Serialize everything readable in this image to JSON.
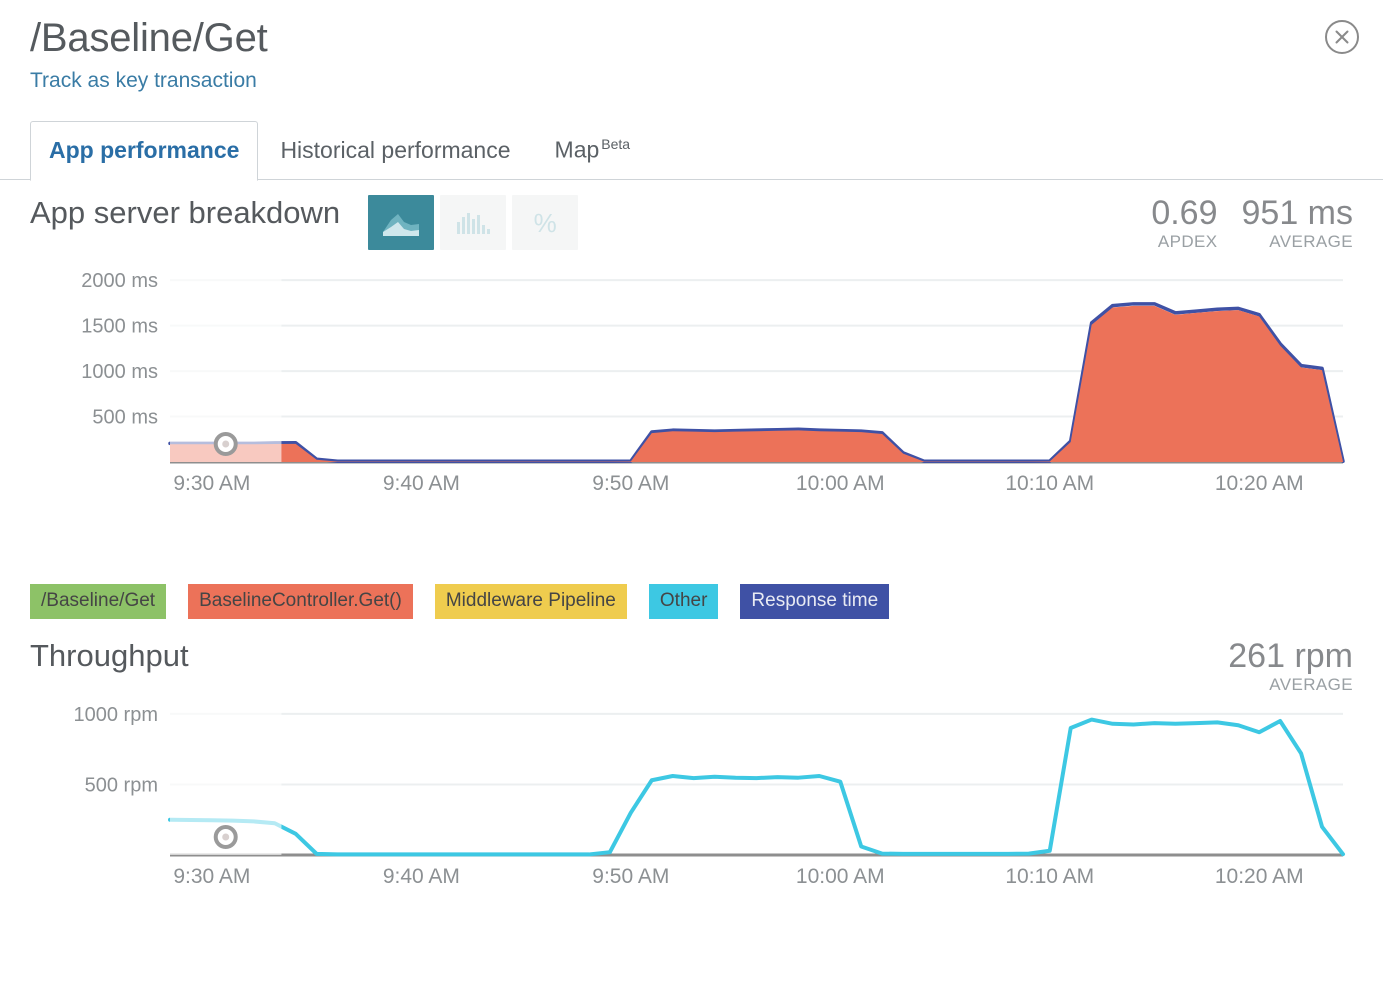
{
  "header": {
    "title": "/Baseline/Get",
    "track_link": "Track as key transaction",
    "close_icon": "close-circle-icon"
  },
  "tabs": [
    {
      "label": "App performance",
      "active": true
    },
    {
      "label": "Historical performance",
      "active": false
    },
    {
      "label": "Map",
      "badge": "Beta",
      "active": false
    }
  ],
  "app_breakdown": {
    "title": "App server breakdown",
    "chart_types": [
      {
        "icon": "area-chart-icon",
        "active": true
      },
      {
        "icon": "bar-chart-icon",
        "active": false
      },
      {
        "icon": "percent-icon",
        "active": false
      }
    ],
    "stats": [
      {
        "value": "0.69",
        "label": "APDEX"
      },
      {
        "value": "951 ms",
        "label": "AVERAGE"
      }
    ]
  },
  "legend": [
    {
      "label": "/Baseline/Get",
      "color": "#8dc267",
      "text_color": "#454545"
    },
    {
      "label": "BaselineController.Get()",
      "color": "#ec7259",
      "text_color": "#454545"
    },
    {
      "label": "Middleware Pipeline",
      "color": "#efcc4e",
      "text_color": "#454545"
    },
    {
      "label": "Other",
      "color": "#3dc8e3",
      "text_color": "#454545"
    },
    {
      "label": "Response time",
      "color": "#3f51a5",
      "text_color": "#e8eaf3"
    }
  ],
  "throughput": {
    "title": "Throughput",
    "stats": [
      {
        "value": "261 rpm",
        "label": "AVERAGE"
      }
    ]
  },
  "colors": {
    "accent_teal": "#3c8a9b",
    "tab_active": "#2a6ea6",
    "link": "#3a7ca5",
    "area_fill": "#ec7259",
    "response_line": "#3f51a5",
    "throughput_line": "#3dc8e3",
    "gridline": "#eceff0",
    "axis": "#8c9093"
  },
  "chart_data": [
    {
      "type": "area",
      "title": "App server breakdown",
      "ylabel": "ms",
      "xlabel": "",
      "ylim": [
        0,
        2200
      ],
      "yticks": [
        500,
        1000,
        1500,
        2000
      ],
      "ytick_labels": [
        "500 ms",
        "1000 ms",
        "1500 ms",
        "2000 ms"
      ],
      "xtick_labels": [
        "9:30 AM",
        "9:40 AM",
        "9:50 AM",
        "10:00 AM",
        "10:10 AM",
        "10:20 AM"
      ],
      "grid": true,
      "legend_position": "below",
      "selection_overlay": {
        "from": "9:28 AM",
        "to": "9:33 AM",
        "handle": "drag-handle"
      },
      "x": [
        "9:28",
        "9:29",
        "9:30",
        "9:31",
        "9:32",
        "9:33",
        "9:34",
        "9:35",
        "9:36",
        "9:37",
        "9:38",
        "9:39",
        "9:40",
        "9:41",
        "9:42",
        "9:43",
        "9:44",
        "9:45",
        "9:46",
        "9:47",
        "9:48",
        "9:49",
        "9:50",
        "9:51",
        "9:52",
        "9:53",
        "9:54",
        "9:55",
        "9:56",
        "9:57",
        "9:58",
        "9:59",
        "10:00",
        "10:01",
        "10:02",
        "10:03",
        "10:04",
        "10:05",
        "10:06",
        "10:07",
        "10:08",
        "10:09",
        "10:10",
        "10:11",
        "10:12",
        "10:13",
        "10:14",
        "10:15",
        "10:16",
        "10:17",
        "10:18",
        "10:19",
        "10:20",
        "10:21",
        "10:22",
        "10:23",
        "10:24"
      ],
      "series": [
        {
          "name": "Response time",
          "color": "#3f51a5",
          "values": [
            205,
            205,
            205,
            205,
            205,
            210,
            212,
            30,
            8,
            8,
            8,
            8,
            8,
            8,
            8,
            8,
            8,
            8,
            8,
            8,
            8,
            8,
            10,
            330,
            350,
            345,
            340,
            345,
            350,
            355,
            360,
            350,
            345,
            340,
            320,
            100,
            8,
            8,
            8,
            8,
            8,
            8,
            10,
            230,
            1530,
            1720,
            1740,
            1740,
            1640,
            1660,
            1680,
            1690,
            1620,
            1300,
            1060,
            1030,
            8
          ]
        },
        {
          "name": "BaselineController.Get()",
          "color": "#ec7259",
          "values": [
            195,
            195,
            195,
            195,
            195,
            198,
            200,
            25,
            4,
            4,
            4,
            4,
            4,
            4,
            4,
            4,
            4,
            4,
            4,
            4,
            4,
            4,
            6,
            318,
            338,
            334,
            328,
            334,
            338,
            344,
            348,
            338,
            334,
            328,
            308,
            92,
            4,
            4,
            4,
            4,
            4,
            4,
            6,
            220,
            1510,
            1700,
            1718,
            1718,
            1618,
            1640,
            1660,
            1670,
            1600,
            1280,
            1040,
            1010,
            4
          ]
        }
      ]
    },
    {
      "type": "line",
      "title": "Throughput",
      "ylabel": "rpm",
      "xlabel": "",
      "ylim": [
        0,
        1120
      ],
      "yticks": [
        500,
        1000
      ],
      "ytick_labels": [
        "500 rpm",
        "1000 rpm"
      ],
      "xtick_labels": [
        "9:30 AM",
        "9:40 AM",
        "9:50 AM",
        "10:00 AM",
        "10:10 AM",
        "10:20 AM"
      ],
      "grid": true,
      "selection_overlay": {
        "from": "9:28 AM",
        "to": "9:33 AM",
        "handle": "drag-handle"
      },
      "x": [
        "9:28",
        "9:29",
        "9:30",
        "9:31",
        "9:32",
        "9:33",
        "9:34",
        "9:35",
        "9:36",
        "9:37",
        "9:38",
        "9:39",
        "9:40",
        "9:41",
        "9:42",
        "9:43",
        "9:44",
        "9:45",
        "9:46",
        "9:47",
        "9:48",
        "9:49",
        "9:50",
        "9:51",
        "9:52",
        "9:53",
        "9:54",
        "9:55",
        "9:56",
        "9:57",
        "9:58",
        "9:59",
        "10:00",
        "10:01",
        "10:02",
        "10:03",
        "10:04",
        "10:05",
        "10:06",
        "10:07",
        "10:08",
        "10:09",
        "10:10",
        "10:11",
        "10:12",
        "10:13",
        "10:14",
        "10:15",
        "10:16",
        "10:17",
        "10:18",
        "10:19",
        "10:20",
        "10:21",
        "10:22",
        "10:23",
        "10:24"
      ],
      "series": [
        {
          "name": "Throughput",
          "color": "#3dc8e3",
          "values": [
            250,
            248,
            246,
            244,
            238,
            225,
            150,
            8,
            4,
            4,
            4,
            4,
            4,
            4,
            4,
            4,
            4,
            4,
            4,
            4,
            4,
            20,
            300,
            530,
            560,
            545,
            555,
            548,
            545,
            552,
            548,
            560,
            520,
            60,
            10,
            8,
            8,
            8,
            8,
            8,
            8,
            10,
            30,
            900,
            960,
            930,
            925,
            935,
            930,
            935,
            940,
            920,
            870,
            950,
            720,
            200,
            6
          ]
        }
      ]
    }
  ]
}
